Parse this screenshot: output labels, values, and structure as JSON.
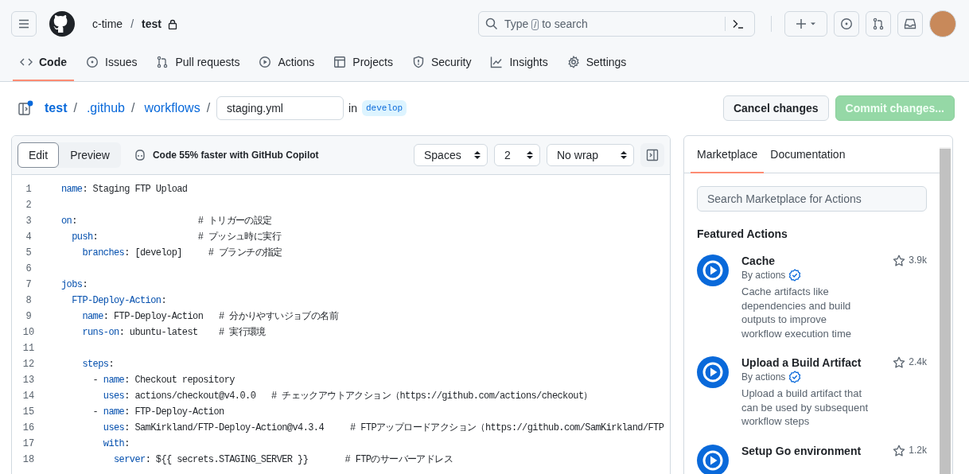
{
  "header": {
    "owner": "c-time",
    "separator": "/",
    "repo": "test",
    "private": true,
    "search": {
      "before": "Type",
      "key": "/",
      "after": "to search"
    }
  },
  "nav": [
    {
      "label": "Code",
      "selected": true
    },
    {
      "label": "Issues",
      "selected": false
    },
    {
      "label": "Pull requests",
      "selected": false
    },
    {
      "label": "Actions",
      "selected": false
    },
    {
      "label": "Projects",
      "selected": false
    },
    {
      "label": "Security",
      "selected": false
    },
    {
      "label": "Insights",
      "selected": false
    },
    {
      "label": "Settings",
      "selected": false
    }
  ],
  "breadcrumb": {
    "parts": [
      "test",
      "/",
      ".github",
      "/",
      "workflows",
      "/"
    ],
    "filename": "staging.yml",
    "in_label": "in",
    "branch": "develop"
  },
  "actions": [
    {
      "label": "Cancel changes",
      "kind": "default",
      "disabled": false
    },
    {
      "label": "Commit changes...",
      "kind": "primary",
      "disabled": true
    }
  ],
  "editor": {
    "modes": [
      {
        "label": "Edit",
        "selected": true
      },
      {
        "label": "Preview",
        "selected": false
      }
    ],
    "copilot": "Code 55% faster with GitHub Copilot",
    "selects": [
      "Spaces",
      "2",
      "No wrap"
    ],
    "lines": [
      {
        "number": "1",
        "segments": [
          {
            "text": "name",
            "kind": "key"
          },
          {
            "text": ": Staging FTP Upload",
            "kind": "plain"
          }
        ]
      },
      {
        "number": "2"
      },
      {
        "number": "3",
        "segments": [
          {
            "text": "on",
            "kind": "key"
          },
          {
            "text": ":                       # トリガーの設定",
            "kind": "plain"
          }
        ]
      },
      {
        "number": "4",
        "segments": [
          {
            "text": "  push",
            "kind": "key"
          },
          {
            "text": ":                   # プッシュ時に実行",
            "kind": "plain"
          }
        ]
      },
      {
        "number": "5",
        "segments": [
          {
            "text": "    branches",
            "kind": "key"
          },
          {
            "text": ": [develop]     # ブランチの指定",
            "kind": "plain"
          }
        ]
      },
      {
        "number": "6"
      },
      {
        "number": "7",
        "segments": [
          {
            "text": "jobs",
            "kind": "key"
          },
          {
            "text": ":",
            "kind": "plain"
          }
        ]
      },
      {
        "number": "8",
        "segments": [
          {
            "text": "  FTP-Deploy-Action",
            "kind": "key"
          },
          {
            "text": ":",
            "kind": "plain"
          }
        ]
      },
      {
        "number": "9",
        "segments": [
          {
            "text": "    name",
            "kind": "key"
          },
          {
            "text": ": FTP-Deploy-Action   # 分かりやすいジョブの名前",
            "kind": "plain"
          }
        ]
      },
      {
        "number": "10",
        "segments": [
          {
            "text": "    runs-on",
            "kind": "key"
          },
          {
            "text": ": ubuntu-latest    # 実行環境",
            "kind": "plain"
          }
        ]
      },
      {
        "number": "11"
      },
      {
        "number": "12",
        "segments": [
          {
            "text": "    steps",
            "kind": "key"
          },
          {
            "text": ":",
            "kind": "plain"
          }
        ]
      },
      {
        "number": "13",
        "segments": [
          {
            "text": "      - ",
            "kind": "plain"
          },
          {
            "text": "name",
            "kind": "key"
          },
          {
            "text": ": Checkout repository",
            "kind": "plain"
          }
        ]
      },
      {
        "number": "14",
        "segments": [
          {
            "text": "        uses",
            "kind": "key"
          },
          {
            "text": ": actions/checkout@v4.0.0   # チェックアウトアクション（https://github.com/actions/checkout）",
            "kind": "plain"
          }
        ]
      },
      {
        "number": "15",
        "segments": [
          {
            "text": "      - ",
            "kind": "plain"
          },
          {
            "text": "name",
            "kind": "key"
          },
          {
            "text": ": FTP-Deploy-Action",
            "kind": "plain"
          }
        ]
      },
      {
        "number": "16",
        "segments": [
          {
            "text": "        uses",
            "kind": "key"
          },
          {
            "text": ": SamKirkland/FTP-Deploy-Action@v4.3.4     # FTPアップロードアクション（https://github.com/SamKirkland/FTP",
            "kind": "plain"
          }
        ]
      },
      {
        "number": "17",
        "segments": [
          {
            "text": "        with",
            "kind": "key"
          },
          {
            "text": ":",
            "kind": "plain"
          }
        ]
      },
      {
        "number": "18",
        "segments": [
          {
            "text": "          server",
            "kind": "key"
          },
          {
            "text": ": ${{ secrets.STAGING_SERVER }}       # FTPのサーバーアドレス",
            "kind": "plain"
          }
        ]
      }
    ]
  },
  "marketplace": {
    "tabs": [
      {
        "label": "Marketplace",
        "selected": true
      },
      {
        "label": "Documentation",
        "selected": false
      }
    ],
    "search": {
      "placeholder": "Search Marketplace for Actions"
    },
    "heading": "Featured Actions",
    "items": [
      {
        "title": "Cache",
        "author": "By actions",
        "verified": true,
        "star_count": "3.9k",
        "description": "Cache artifacts like dependencies and build outputs to improve workflow execution time"
      },
      {
        "title": "Upload a Build Artifact",
        "author": "By actions",
        "verified": true,
        "star_count": "2.4k",
        "description": "Upload a build artifact that can be used by subsequent workflow steps"
      },
      {
        "title": "Setup Go environment",
        "star_count": "1.2k"
      }
    ]
  }
}
